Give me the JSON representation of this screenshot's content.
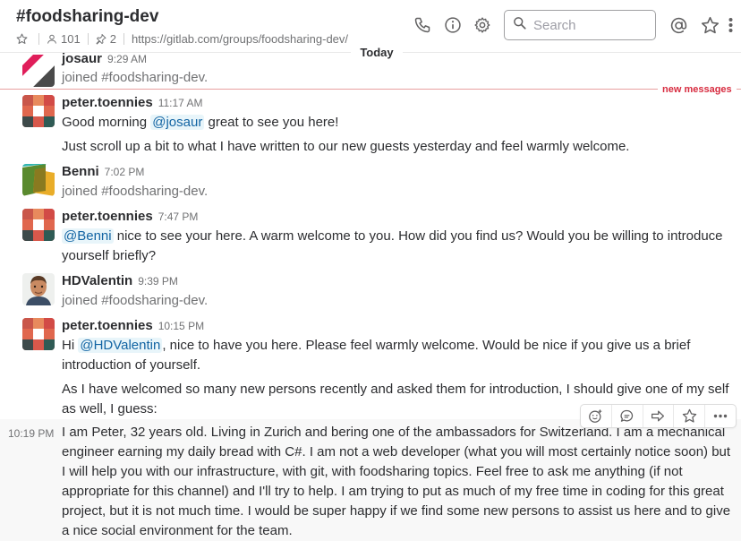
{
  "header": {
    "channel": "#foodsharing-dev",
    "member_count": "101",
    "pinned_count": "2",
    "link": "https://gitlab.com/groups/foodsharing-dev/",
    "search_placeholder": "Search"
  },
  "divider": {
    "day": "Today",
    "new_messages": "new messages"
  },
  "messages": [
    {
      "author": "josaur",
      "time": "9:29 AM",
      "lines": [
        "joined #foodsharing-dev."
      ]
    },
    {
      "author": "peter.toennies",
      "time": "11:17 AM",
      "line1_pre": "Good morning ",
      "line1_mention": "@josaur",
      "line1_post": " great to see you here!",
      "line2": "Just scroll up a bit to what I have written to our new guests yesterday and feel warmly welcome."
    },
    {
      "author": "Benni",
      "time": "7:02 PM",
      "lines": [
        "joined #foodsharing-dev."
      ]
    },
    {
      "author": "peter.toennies",
      "time": "7:47 PM",
      "mention": "@Benni",
      "post": " nice to see your here. A warm welcome to you. How did you find us? Would you be willing to introduce yourself briefly?"
    },
    {
      "author": "HDValentin",
      "time": "9:39 PM",
      "lines": [
        "joined #foodsharing-dev."
      ]
    },
    {
      "author": "peter.toennies",
      "time": "10:15 PM",
      "pre": "Hi ",
      "mention": "@HDValentin",
      "post": ", nice to have you here. Please feel warmly welcome. Would be nice if you give us a brief introduction of yourself.",
      "line2": "As I have welcomed so many new persons recently and asked them for introduction, I should give one of my self as well, I guess:"
    },
    {
      "time": "10:19 PM",
      "text": "I am Peter, 32 years old. Living in Zurich and bering one of the ambassadors for Switzerland. I am a mechanical engineer earning my daily bread with C#. I am not a web developer (what you will most certainly notice soon) but I will help you with our infrastructure, with git, with foodsharing topics. Feel free to ask me anything (if not appropriate for this channel) and I'll try to help. I am trying to put as much of my free time in coding for this great project, but it is not much time. I would be super happy if we find some new persons to assist us here and to give a nice social environment for the team."
    }
  ],
  "icons": {
    "star": "star-icon",
    "member": "person-icon",
    "pin": "pin-icon",
    "call": "phone-icon",
    "info": "info-icon",
    "settings": "gear-icon",
    "search": "search-icon",
    "mentions": "at-sign-icon",
    "starred": "star-icon",
    "more": "more-vertical-icon"
  }
}
